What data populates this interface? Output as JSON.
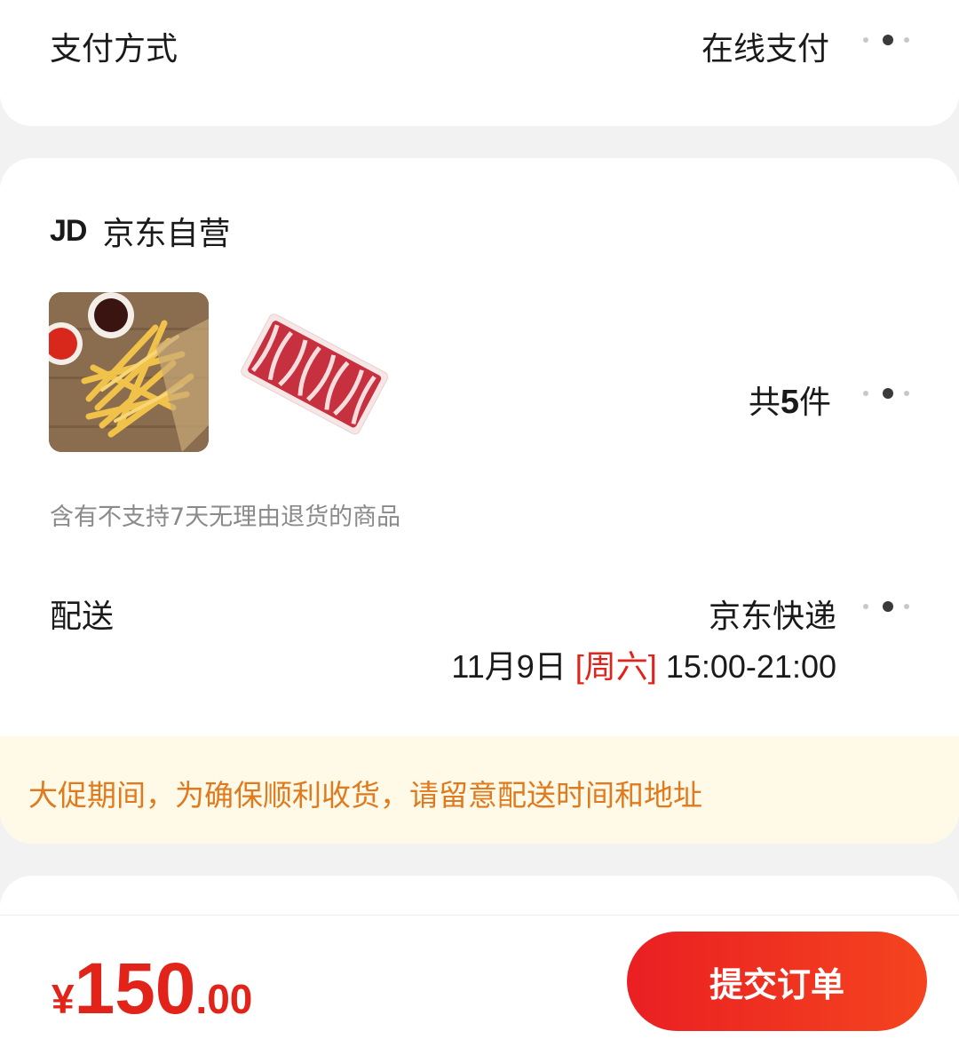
{
  "payment": {
    "label": "支付方式",
    "value": "在线支付"
  },
  "shop": {
    "logo": "JD",
    "name": "京东自营",
    "products": [
      {
        "name": "fries"
      },
      {
        "name": "beef-slices"
      }
    ],
    "count_prefix": "共",
    "count_value": "5",
    "count_suffix": "件",
    "return_notice": "含有不支持7天无理由退货的商品",
    "delivery": {
      "label": "配送",
      "company": "京东快递",
      "date": "11月9日",
      "weekday": "[周六]",
      "time": "15:00-21:00"
    },
    "promo_notice": "大促期间，为确保顺利收货，请留意配送时间和地址"
  },
  "footer": {
    "currency": "¥",
    "price_int": "150",
    "price_dec": ".00",
    "submit_label": "提交订单"
  },
  "colors": {
    "accent": "#e2231a",
    "promo_bg": "#fff9e8",
    "promo_text": "#e07a1e"
  }
}
